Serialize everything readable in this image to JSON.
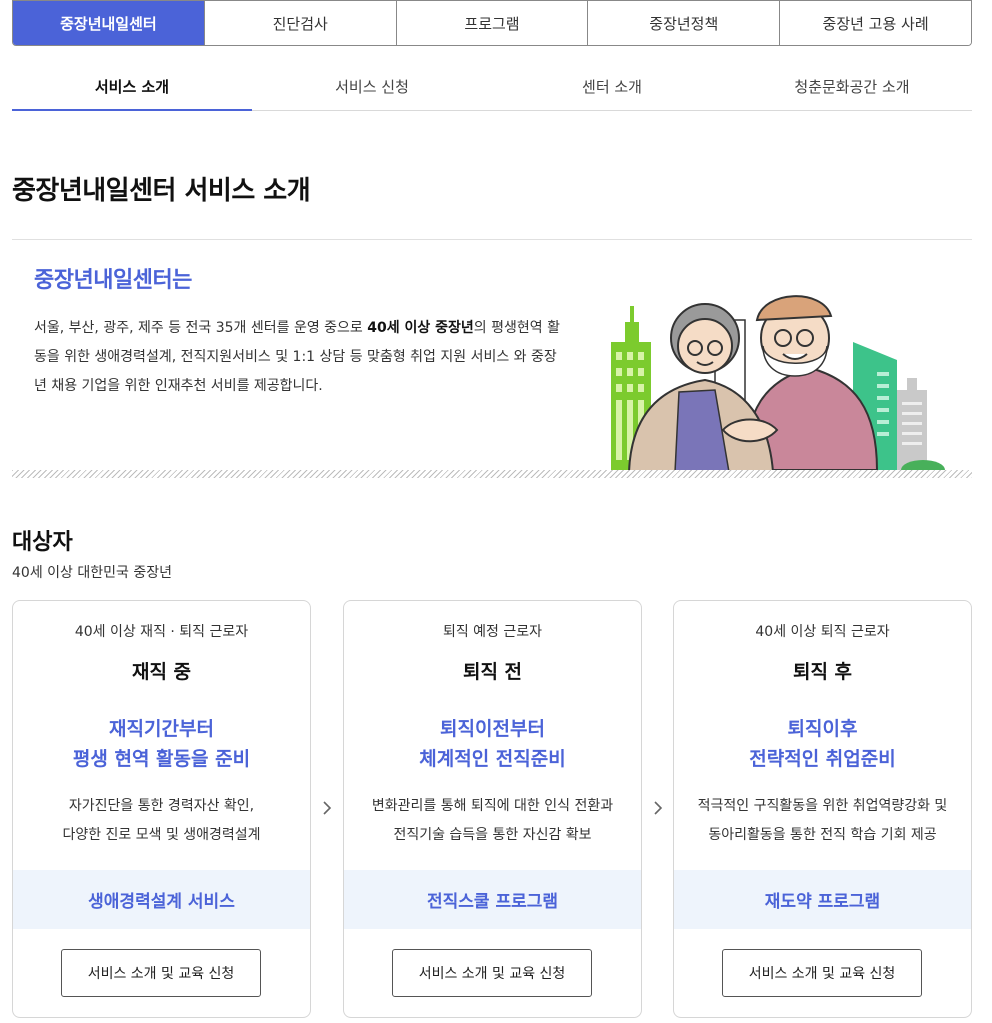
{
  "main_tabs": [
    "중장년내일센터",
    "진단검사",
    "프로그램",
    "중장년정책",
    "중장년 고용 사례"
  ],
  "sub_tabs": [
    "서비스 소개",
    "서비스 신청",
    "센터 소개",
    "청춘문화공간 소개"
  ],
  "page_title": "중장년내일센터 서비스 소개",
  "intro": {
    "heading": "중장년내일센터는",
    "text_before": "서울, 부산, 광주, 제주 등 전국 35개 센터를 운영 중으로 ",
    "text_bold": "40세 이상 중장년",
    "text_after": "의 평생현역 활동을 위한 생애경력설계, 전직지원서비스 및 1:1 상담 등 맞춤형 취업 지원 서비스 와 중장년 채용 기업을 위한 인재추천 서비를 제공합니다."
  },
  "target": {
    "heading": "대상자",
    "subtitle": "40세 이상 대한민국 중장년"
  },
  "cards": [
    {
      "label": "40세 이상 재직 · 퇴직 근로자",
      "stage": "재직 중",
      "headline_1": "재직기간부터",
      "headline_2": "평생 현역 활동을 준비",
      "desc_1": "자가진단을 통한 경력자산 확인,",
      "desc_2": "다양한 진로 모색 및 생애경력설계",
      "program": "생애경력설계 서비스",
      "button": "서비스 소개 및 교육 신청"
    },
    {
      "label": "퇴직 예정 근로자",
      "stage": "퇴직 전",
      "headline_1": "퇴직이전부터",
      "headline_2": "체계적인 전직준비",
      "desc_1": "변화관리를 통해 퇴직에 대한 인식 전환과",
      "desc_2": "전직기술 습득을 통한 자신감 확보",
      "program": "전직스쿨 프로그램",
      "button": "서비스 소개 및 교육 신청"
    },
    {
      "label": "40세 이상 퇴직 근로자",
      "stage": "퇴직 후",
      "headline_1": "퇴직이후",
      "headline_2": "전략적인 취업준비",
      "desc_1": "적극적인 구직활동을 위한 취업역량강화 및",
      "desc_2": "동아리활동을 통한 전직 학습 기회 제공",
      "program": "재도약 프로그램",
      "button": "서비스 소개 및 교육 신청"
    }
  ],
  "colors": {
    "accent": "#4b63d8",
    "band": "#eef4fc"
  },
  "icons": [
    "chevron-right-icon",
    "senior-couple-illustration"
  ]
}
